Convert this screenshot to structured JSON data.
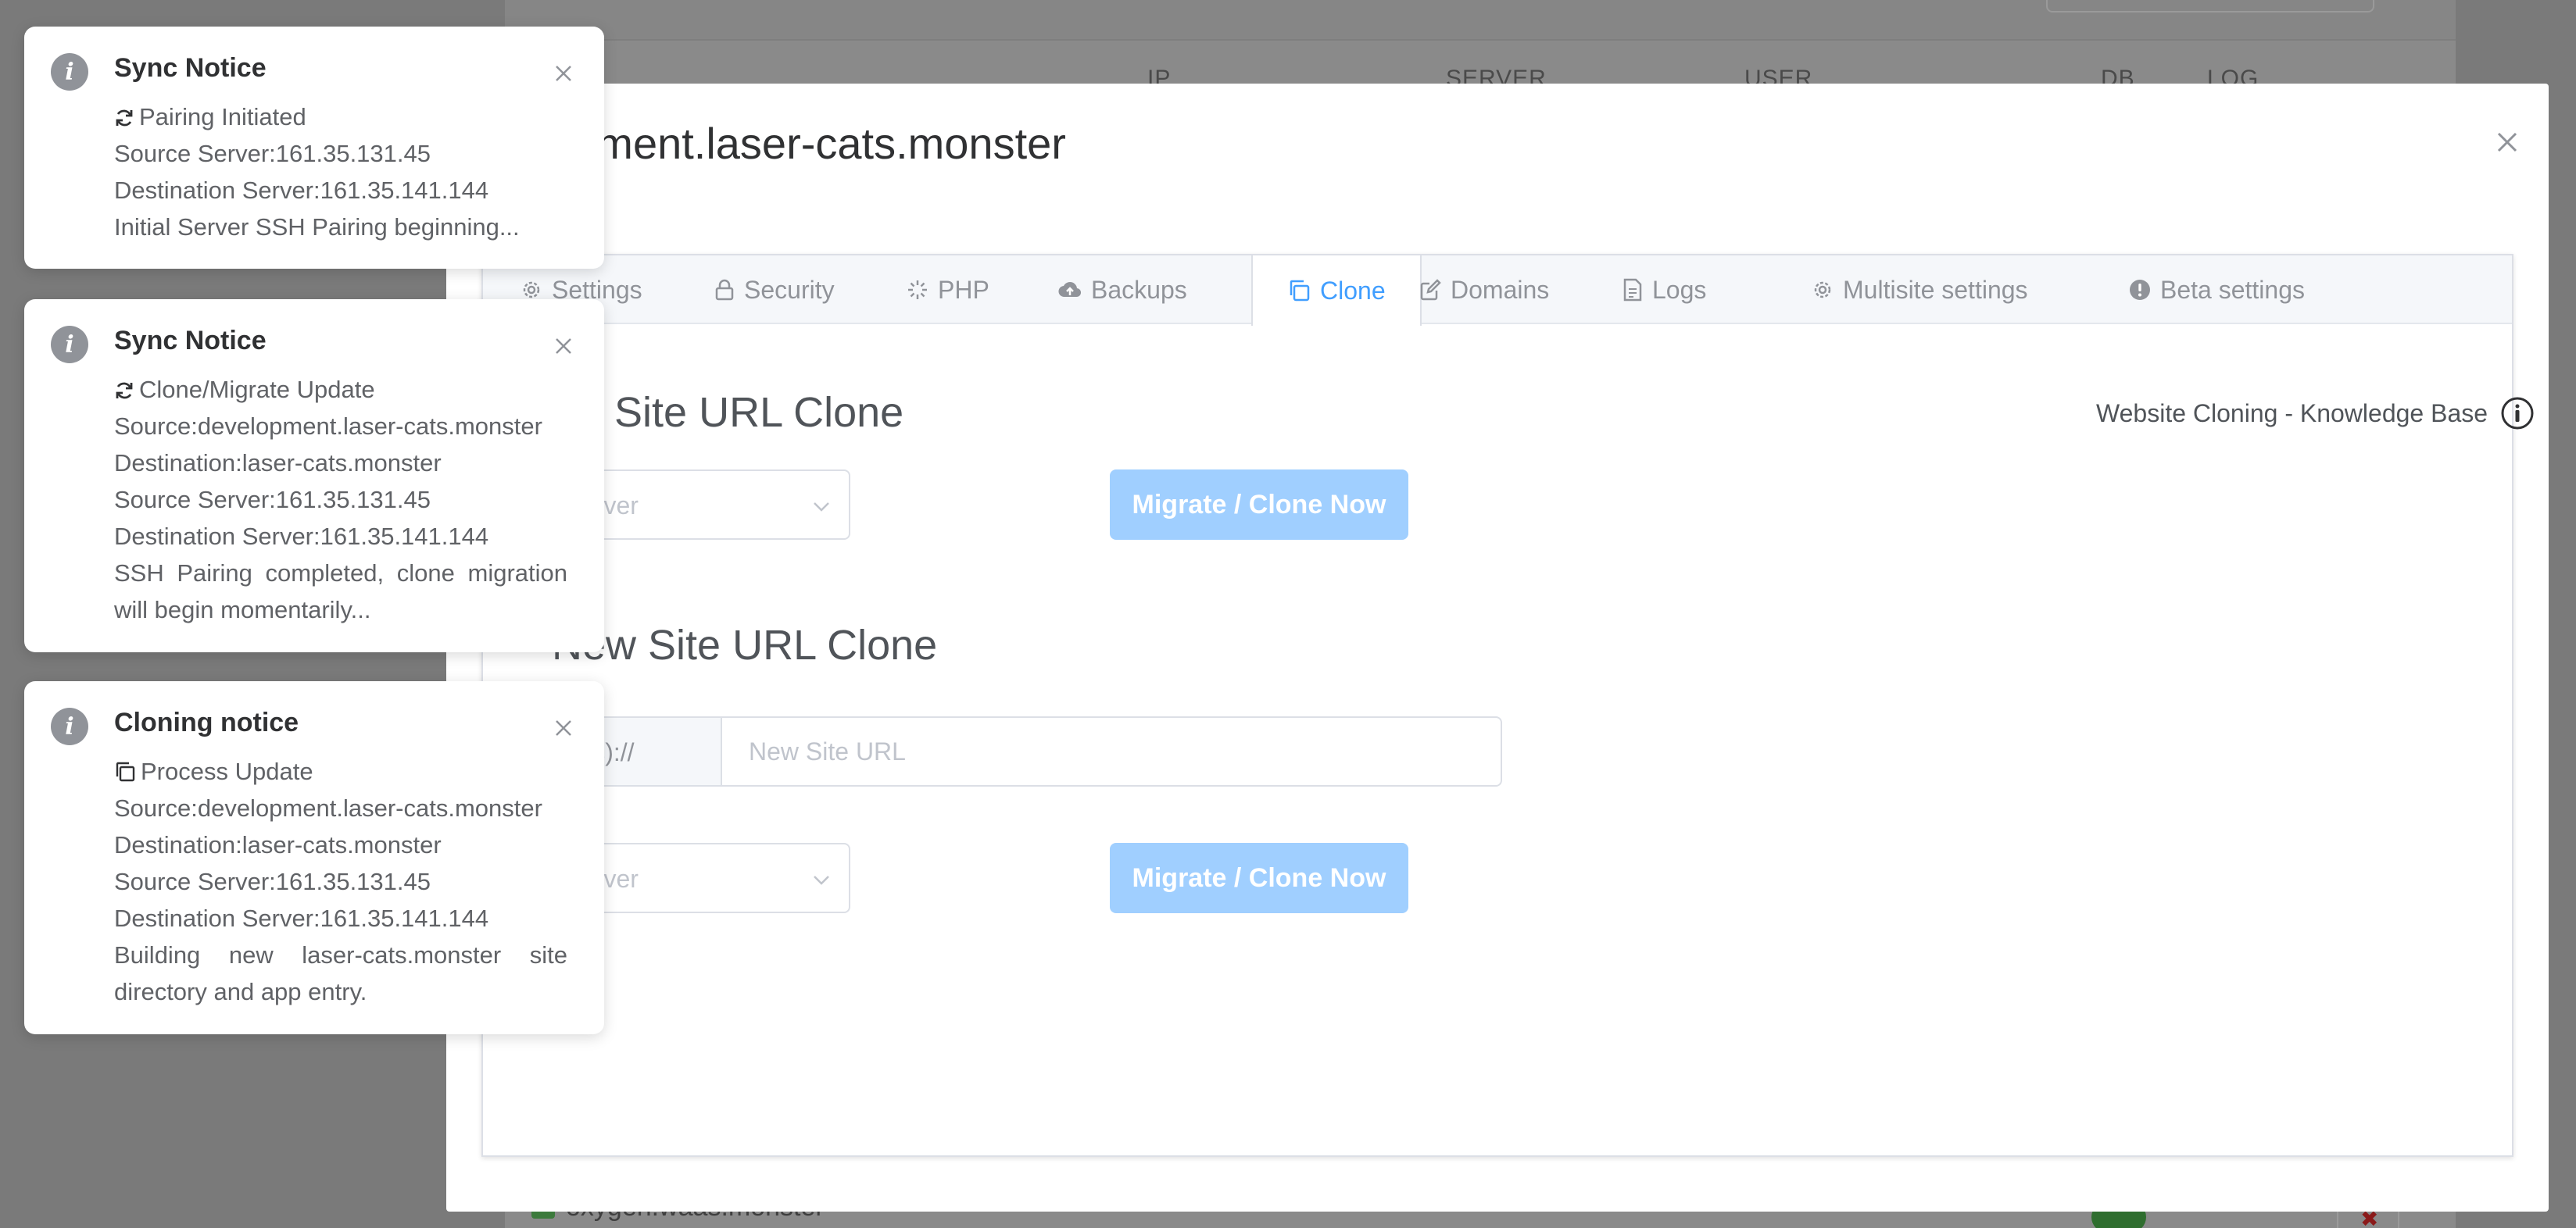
{
  "background": {
    "columns": [
      "IP",
      "SERVER",
      "USER",
      "DB",
      "LOG"
    ],
    "row_site": "oxygen.waas.monster"
  },
  "modal": {
    "title": "opment.laser-cats.monster",
    "tabs": [
      {
        "label": "Settings",
        "icon": "gear-icon"
      },
      {
        "label": "Security",
        "icon": "lock-icon"
      },
      {
        "label": "PHP",
        "icon": "loading-icon"
      },
      {
        "label": "Backups",
        "icon": "cloud-upload-icon"
      },
      {
        "label": "Clone",
        "icon": "copy-icon",
        "active": true
      },
      {
        "label": "Domains",
        "icon": "edit-icon"
      },
      {
        "label": "Logs",
        "icon": "document-icon"
      },
      {
        "label": "Multisite settings",
        "icon": "gear-icon"
      },
      {
        "label": "Beta settings",
        "icon": "warning-icon"
      }
    ],
    "same_site": {
      "heading": "me Site URL Clone",
      "select_placeholder": "lect Server",
      "button": "Migrate / Clone Now"
    },
    "knowledge_base": "Website Cloning - Knowledge Base",
    "new_site": {
      "heading": "New Site URL Clone",
      "prefix": "ttp(s)://",
      "url_placeholder": "New Site URL",
      "select_placeholder": "lect Server",
      "button": "Migrate / Clone Now"
    }
  },
  "notifications": [
    {
      "title": "Sync Notice",
      "lines": [
        "Pairing Initiated",
        "Source Server:161.35.131.45",
        "Destination Server:161.35.141.144",
        "Initial Server SSH Pairing beginning..."
      ]
    },
    {
      "title": "Sync Notice",
      "lines": [
        "Clone/Migrate Update",
        "Source:development.laser-cats.monster",
        "Destination:laser-cats.monster",
        "Source Server:161.35.131.45",
        "Destination Server:161.35.141.144",
        "SSH Pairing completed, clone migration will begin momentarily..."
      ]
    },
    {
      "title": "Cloning notice",
      "lines": [
        "Process Update",
        "Source:development.laser-cats.monster",
        "Destination:laser-cats.monster",
        "Source Server:161.35.131.45",
        "Destination Server:161.35.141.144",
        "Building new laser-cats.monster site directory and app entry."
      ]
    }
  ],
  "colors": {
    "accent": "#409eff",
    "button_disabled": "#a0cfff",
    "overlay": "#7a7a7a"
  }
}
